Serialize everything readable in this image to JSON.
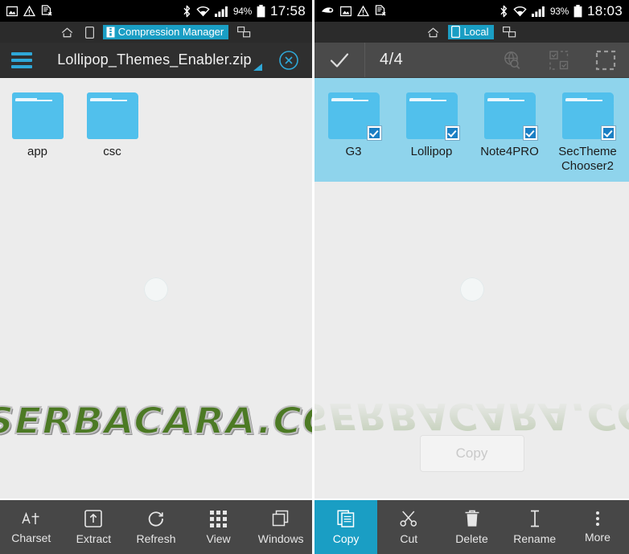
{
  "left": {
    "status_bar": {
      "icons": [
        "screenshot-icon",
        "warning-icon",
        "sim-card-error-icon"
      ],
      "bluetooth": "bluetooth-icon",
      "wifi": "wifi-icon",
      "signal": "signal-icon",
      "battery_percent": "94%",
      "battery": "battery-icon",
      "clock": "17:58"
    },
    "breadcrumb": {
      "home": "home-icon",
      "device": "device-icon",
      "active_label": "Compression Manager",
      "active_icon": "archive-icon",
      "network_icon": "network-icon"
    },
    "header": {
      "menu_icon": "hamburger-menu-icon",
      "title": "Lollipop_Themes_Enabler.zip",
      "close_icon": "close-circle-icon",
      "resize_handle": "resize-handle-icon"
    },
    "files": [
      {
        "name": "app",
        "type": "folder",
        "selected": false
      },
      {
        "name": "csc",
        "type": "folder",
        "selected": false
      }
    ],
    "toolbar": [
      {
        "label": "Charset",
        "icon": "charset-icon",
        "highlighted": false
      },
      {
        "label": "Extract",
        "icon": "extract-icon",
        "highlighted": false
      },
      {
        "label": "Refresh",
        "icon": "refresh-icon",
        "highlighted": false
      },
      {
        "label": "View",
        "icon": "grid-view-icon",
        "highlighted": false
      },
      {
        "label": "Windows",
        "icon": "windows-icon",
        "highlighted": false
      }
    ]
  },
  "right": {
    "status_bar": {
      "icons": [
        "eye-icon",
        "screenshot-icon",
        "warning-icon",
        "sim-card-error-icon"
      ],
      "bluetooth": "bluetooth-icon",
      "wifi": "wifi-icon",
      "signal": "signal-icon",
      "battery_percent": "93%",
      "battery": "battery-icon",
      "clock": "18:03"
    },
    "breadcrumb": {
      "home": "home-icon",
      "active_label": "Local",
      "active_icon": "device-icon",
      "network_icon": "network-icon"
    },
    "header": {
      "confirm_icon": "checkmark-icon",
      "selection_count": "4/4",
      "actions": [
        {
          "icon": "globe-search-icon"
        },
        {
          "icon": "invert-selection-icon"
        },
        {
          "icon": "select-all-icon"
        }
      ]
    },
    "files": [
      {
        "name": "G3",
        "type": "folder",
        "selected": true
      },
      {
        "name": "Lollipop",
        "type": "folder",
        "selected": true
      },
      {
        "name": "Note4PRO",
        "type": "folder",
        "selected": true
      },
      {
        "name": "SecTheme Chooser2",
        "type": "folder",
        "selected": true
      }
    ],
    "float_button": {
      "label": "Copy",
      "enabled": false
    },
    "toolbar": [
      {
        "label": "Copy",
        "icon": "copy-icon",
        "highlighted": true
      },
      {
        "label": "Cut",
        "icon": "scissors-icon",
        "highlighted": false
      },
      {
        "label": "Delete",
        "icon": "trash-icon",
        "highlighted": false
      },
      {
        "label": "Rename",
        "icon": "text-cursor-icon",
        "highlighted": false
      },
      {
        "label": "More",
        "icon": "more-vertical-icon",
        "highlighted": false
      }
    ]
  },
  "watermark": {
    "text": "SERBACARA.COM"
  },
  "colors": {
    "accent": "#1a9ec4",
    "folder": "#51c0ec",
    "selection": "#8fd4ec",
    "toolbar_bg": "#474747",
    "header_bg": "#2f2f2f",
    "body_bg": "#ececec",
    "watermark_green": "#4c7a24"
  }
}
